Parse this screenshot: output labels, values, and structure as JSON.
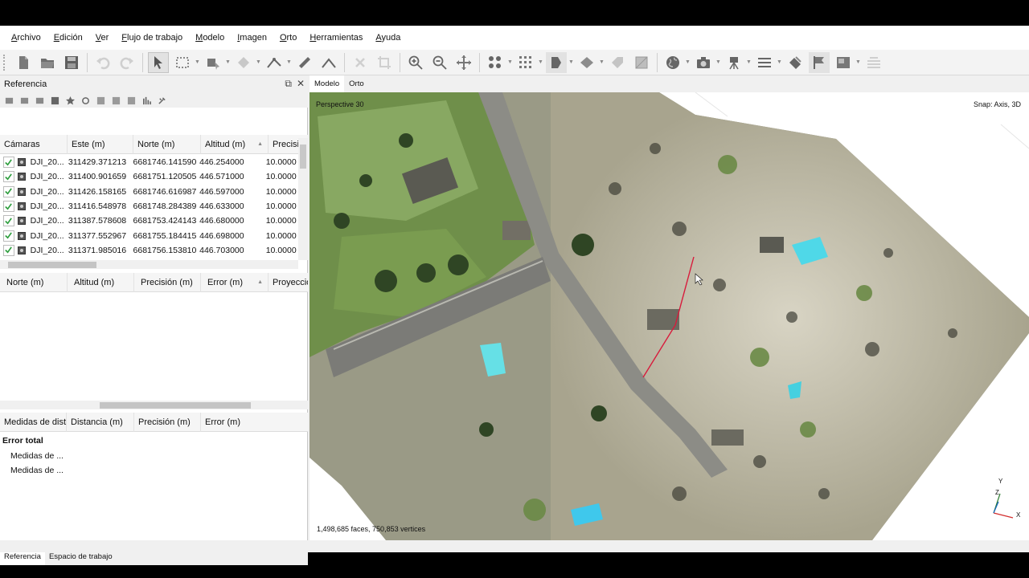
{
  "menu": [
    "Archivo",
    "Edición",
    "Ver",
    "Flujo de trabajo",
    "Modelo",
    "Imagen",
    "Orto",
    "Herramientas",
    "Ayuda"
  ],
  "toolbar": {
    "icons": [
      "new-icon",
      "open-icon",
      "save-icon",
      "undo-icon",
      "redo-icon",
      "select-icon",
      "rect-select-icon",
      "shape-select-icon",
      "fill-icon",
      "draw-polyline-icon",
      "ruler-icon",
      "angle-icon",
      "delete-icon",
      "crop-icon",
      "zoom-in-icon",
      "zoom-out-icon",
      "move-icon",
      "points-icon",
      "grid-icon",
      "mask-icon",
      "plane-icon",
      "tag-icon",
      "texture-icon",
      "globe-icon",
      "camera-icon",
      "camera-tripod-icon",
      "menu-icon",
      "marker-icon",
      "flag-icon",
      "image-icon",
      "layers-icon"
    ]
  },
  "reference": {
    "title": "Referencia",
    "cameras": {
      "columns": [
        "Cámaras",
        "Este (m)",
        "Norte (m)",
        "Altitud (m)",
        "Precisió"
      ],
      "rows": [
        {
          "name": "DJI_20...",
          "este": "311429.371213",
          "norte": "6681746.141590",
          "altitud": "446.254000",
          "precision": "10.0000"
        },
        {
          "name": "DJI_20...",
          "este": "311400.901659",
          "norte": "6681751.120505",
          "altitud": "446.571000",
          "precision": "10.0000"
        },
        {
          "name": "DJI_20...",
          "este": "311426.158165",
          "norte": "6681746.616987",
          "altitud": "446.597000",
          "precision": "10.0000"
        },
        {
          "name": "DJI_20...",
          "este": "311416.548978",
          "norte": "6681748.284389",
          "altitud": "446.633000",
          "precision": "10.0000"
        },
        {
          "name": "DJI_20...",
          "este": "311387.578608",
          "norte": "6681753.424143",
          "altitud": "446.680000",
          "precision": "10.0000"
        },
        {
          "name": "DJI_20...",
          "este": "311377.552967",
          "norte": "6681755.184415",
          "altitud": "446.698000",
          "precision": "10.0000"
        },
        {
          "name": "DJI_20...",
          "este": "311371.985016",
          "norte": "6681756.153810",
          "altitud": "446.703000",
          "precision": "10.0000"
        }
      ]
    },
    "markers": {
      "columns": [
        "Norte (m)",
        "Altitud (m)",
        "Precisión (m)",
        "Error (m)",
        "Proyeccio"
      ]
    },
    "scales": {
      "columns": [
        "Medidas de dista",
        "Distancia (m)",
        "Precisión (m)",
        "Error (m)"
      ],
      "total_label": "Error total",
      "items": [
        "Medidas de ...",
        "Medidas de ..."
      ]
    },
    "tabs": [
      "Referencia",
      "Espacio de trabajo"
    ]
  },
  "view": {
    "tabs": [
      "Modelo",
      "Orto"
    ],
    "perspective": "Perspective 30",
    "snap": "Snap: Axis, 3D",
    "stats": "1,498,685 faces, 750,853 vertices",
    "axis": {
      "x": "X",
      "y": "Y",
      "z": "Z"
    }
  },
  "colors": {
    "check": "#2e9e3e",
    "axis_x": "#d32f2f",
    "axis_y": "#2e7d32",
    "axis_z": "#1565c0",
    "polyline": "#d81b3c"
  }
}
